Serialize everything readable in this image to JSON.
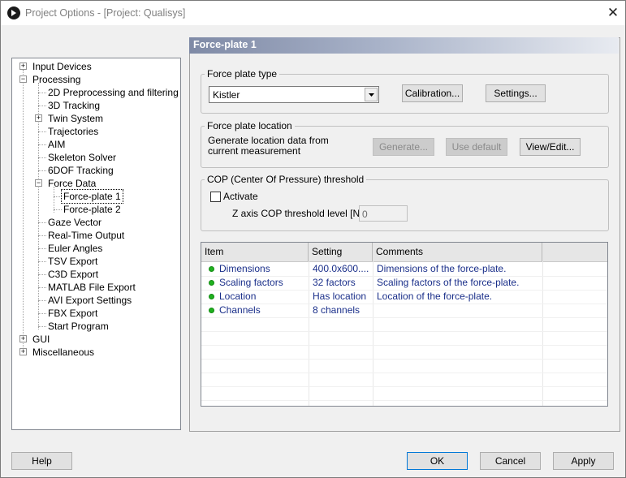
{
  "window": {
    "title": "Project Options - [Project: Qualisys]"
  },
  "tree": {
    "items": [
      {
        "label": "Input Devices"
      },
      {
        "label": "Processing"
      },
      {
        "label": "2D Preprocessing and filtering"
      },
      {
        "label": "3D Tracking"
      },
      {
        "label": "Twin System"
      },
      {
        "label": "Trajectories"
      },
      {
        "label": "AIM"
      },
      {
        "label": "Skeleton Solver"
      },
      {
        "label": "6DOF Tracking"
      },
      {
        "label": "Force Data"
      },
      {
        "label": "Force-plate 1"
      },
      {
        "label": "Force-plate 2"
      },
      {
        "label": "Gaze Vector"
      },
      {
        "label": "Real-Time Output"
      },
      {
        "label": "Euler Angles"
      },
      {
        "label": "TSV Export"
      },
      {
        "label": "C3D Export"
      },
      {
        "label": "MATLAB File Export"
      },
      {
        "label": "AVI Export Settings"
      },
      {
        "label": "FBX Export"
      },
      {
        "label": "Start Program"
      },
      {
        "label": "GUI"
      },
      {
        "label": "Miscellaneous"
      }
    ]
  },
  "panel": {
    "header": "Force-plate 1",
    "type_group": {
      "title": "Force plate type",
      "selected": "Kistler",
      "calibration_label": "Calibration...",
      "settings_label": "Settings..."
    },
    "location_group": {
      "title": "Force plate location",
      "description": "Generate location data from current measurement",
      "generate_label": "Generate...",
      "use_default_label": "Use default",
      "view_edit_label": "View/Edit..."
    },
    "cop_group": {
      "title": "COP (Center Of Pressure) threshold",
      "activate_label": "Activate",
      "z_axis_label": "Z axis COP threshold level [N]:",
      "z_axis_value": "0"
    },
    "grid": {
      "headers": [
        "Item",
        "Setting",
        "Comments"
      ],
      "rows": [
        {
          "item": "Dimensions",
          "setting": "400.0x600....",
          "comment": "Dimensions of the force-plate."
        },
        {
          "item": "Scaling factors",
          "setting": "32 factors",
          "comment": "Scaling factors of the force-plate."
        },
        {
          "item": "Location",
          "setting": "Has location",
          "comment": "Location of the force-plate."
        },
        {
          "item": "Channels",
          "setting": "8 channels",
          "comment": ""
        }
      ]
    }
  },
  "footer": {
    "help_label": "Help",
    "ok_label": "OK",
    "cancel_label": "Cancel",
    "apply_label": "Apply"
  },
  "colors": {
    "status_ok": "#1fb11f",
    "grid_text": "#1a2f8a",
    "header_gradient_start": "#7f8aa6"
  }
}
